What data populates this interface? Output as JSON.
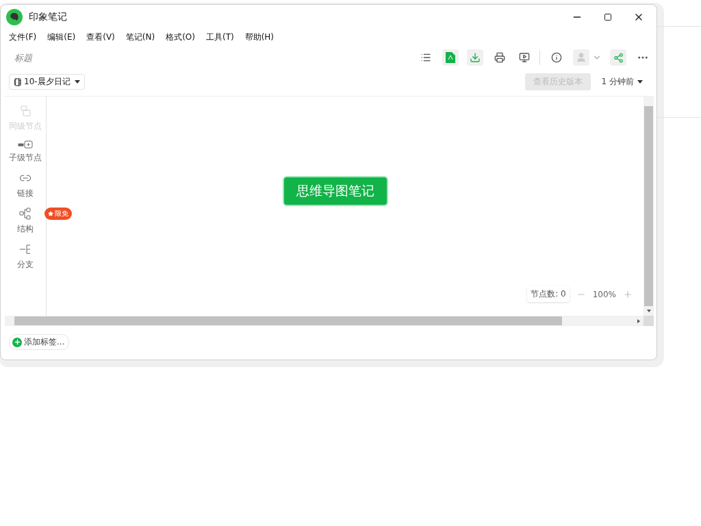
{
  "window": {
    "title": "印象笔记"
  },
  "menu": [
    "文件(F)",
    "编辑(E)",
    "查看(V)",
    "笔记(N)",
    "格式(O)",
    "工具(T)",
    "帮助(H)"
  ],
  "note": {
    "title_placeholder": "标题",
    "notebook": "10-晨夕日记",
    "history_button": "查看历史版本",
    "history_disabled": true,
    "saved_time": "1 分钟前"
  },
  "tools": [
    {
      "label": "同级节点",
      "disabled": true
    },
    {
      "label": "子级节点",
      "disabled": false
    },
    {
      "label": "链接",
      "disabled": false
    },
    {
      "label": "结构",
      "disabled": false,
      "badge": "限免"
    },
    {
      "label": "分支",
      "disabled": false
    }
  ],
  "mindmap": {
    "root": "思维导图笔记",
    "node_count": "节点数: 0",
    "zoom": "100%"
  },
  "tags": {
    "add": "添加标签..."
  }
}
